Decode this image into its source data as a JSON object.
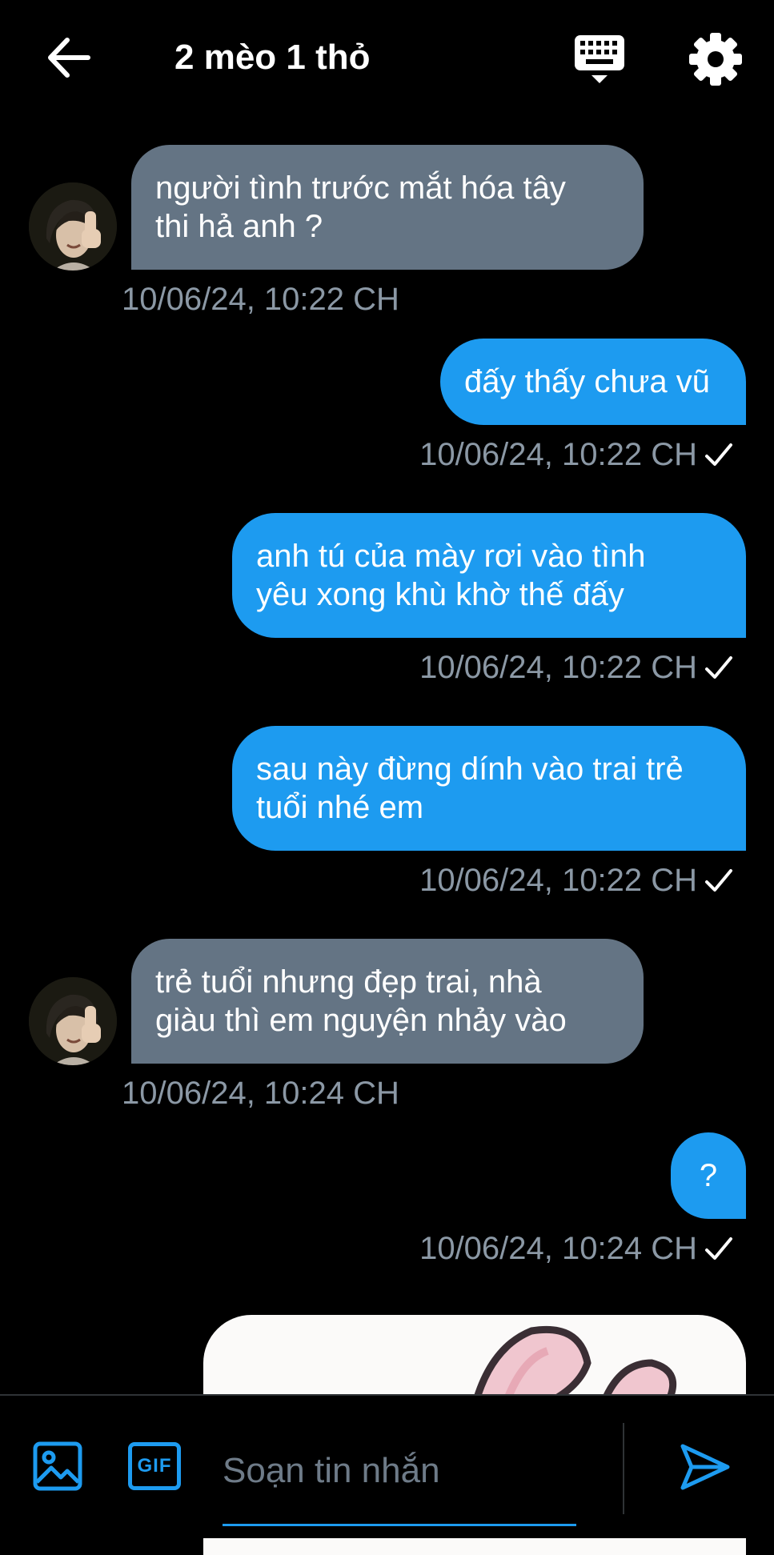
{
  "header": {
    "title": "2 mèo 1 thỏ",
    "back_icon": "arrow-left-icon",
    "keyboard_icon": "keyboard-icon",
    "settings_icon": "gear-icon"
  },
  "messages": [
    {
      "direction": "incoming",
      "lines": [
        "người tình trước mắt hóa tây",
        "thi hả anh ?"
      ],
      "time": "10/06/24, 10:22 CH"
    },
    {
      "direction": "outgoing",
      "lines": [
        "đấy thấy chưa vũ"
      ],
      "time": "10/06/24, 10:22 CH",
      "status": "sent"
    },
    {
      "direction": "outgoing",
      "lines": [
        "anh tú của mày rơi vào tình",
        "yêu xong khù khờ thế đấy"
      ],
      "time": "10/06/24, 10:22 CH",
      "status": "sent"
    },
    {
      "direction": "outgoing",
      "lines": [
        "sau này đừng dính vào trai trẻ",
        "tuổi nhé em"
      ],
      "time": "10/06/24, 10:22 CH",
      "status": "sent"
    },
    {
      "direction": "incoming",
      "lines": [
        "trẻ tuổi nhưng đẹp trai, nhà",
        "giàu thì em nguyện nhảy vào"
      ],
      "time": "10/06/24, 10:24 CH"
    },
    {
      "direction": "outgoing",
      "lines": [
        "?"
      ],
      "time": "10/06/24, 10:24 CH",
      "status": "sent"
    }
  ],
  "composer": {
    "placeholder": "Soạn tin nhắn",
    "media_icon": "image-icon",
    "gif_label": "GIF",
    "send_icon": "send-icon"
  },
  "colors": {
    "background": "#000000",
    "incoming_bubble": "#647484",
    "outgoing_bubble": "#1d9bf0",
    "timestamp": "#8b98a5",
    "accent": "#1d9bf0"
  }
}
